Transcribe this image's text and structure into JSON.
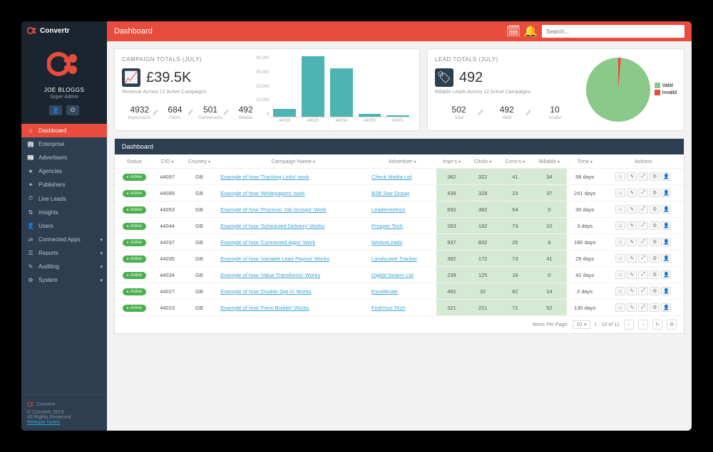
{
  "brand": "Convertr",
  "header": {
    "title": "Dashboard",
    "search_placeholder": "Search..."
  },
  "profile": {
    "name": "JOE BLOGGS",
    "role": "Super Admin"
  },
  "nav": [
    {
      "label": "Dashboard",
      "icon": "⌂",
      "active": true
    },
    {
      "label": "Enterprise",
      "icon": "🏢",
      "expand": false
    },
    {
      "label": "Advertisers",
      "icon": "📰",
      "expand": false
    },
    {
      "label": "Agencies",
      "icon": "★",
      "expand": false
    },
    {
      "label": "Publishers",
      "icon": "✦",
      "expand": false
    },
    {
      "label": "Live Leads",
      "icon": "⏱",
      "expand": false
    },
    {
      "label": "Insights",
      "icon": "⇅",
      "expand": false
    },
    {
      "label": "Users",
      "icon": "👤",
      "expand": false
    },
    {
      "label": "Connected Apps",
      "icon": "⇄",
      "expand": true
    },
    {
      "label": "Reports",
      "icon": "☰",
      "expand": true
    },
    {
      "label": "Auditing",
      "icon": "✎",
      "expand": true
    },
    {
      "label": "System",
      "icon": "⚙",
      "expand": true
    }
  ],
  "footer": {
    "copyright": "© Convertr 2019",
    "rights": "All Rights Reserved",
    "link": "Release Notes"
  },
  "campaign_card": {
    "title": "CAMPAIGN TOTALS (JULY)",
    "value": "£39.5K",
    "subtitle": "Revenue Across 12 Active Campaigns",
    "stats": [
      {
        "value": "4932",
        "label": "Impressions"
      },
      {
        "value": "684",
        "label": "Clicks"
      },
      {
        "value": "501",
        "label": "Conversions"
      },
      {
        "value": "492",
        "label": "Billable"
      }
    ]
  },
  "lead_card": {
    "title": "LEAD TOTALS (JULY)",
    "value": "492",
    "subtitle": "Billable Leads Across 12 Active Campaigns",
    "stats": [
      {
        "value": "502",
        "label": "Total"
      },
      {
        "value": "492",
        "label": "Valid"
      },
      {
        "value": "10",
        "label": "Invalid"
      }
    ],
    "legend": [
      {
        "label": "Valid",
        "color": "#8bc98b"
      },
      {
        "label": "Invalid",
        "color": "#e74c3c"
      }
    ]
  },
  "chart_data": {
    "type": "bar",
    "categories": [
      "44035",
      "44023",
      "44004",
      "44053",
      "44001"
    ],
    "values": [
      5000,
      40000,
      32000,
      2000,
      1000
    ],
    "ylim": [
      0,
      40000
    ],
    "y_ticks": [
      "40,000",
      "30,000",
      "20,000",
      "10,000",
      "0"
    ],
    "title": "",
    "xlabel": "",
    "ylabel": ""
  },
  "pie_data": {
    "type": "pie",
    "slices": [
      {
        "name": "Valid",
        "value": 492
      },
      {
        "name": "Invalid",
        "value": 10
      }
    ]
  },
  "table": {
    "title": "Dashboard",
    "columns": [
      "Status",
      "CID",
      "Country",
      "Campaign Name",
      "Advertiser",
      "Impr's",
      "Clicks",
      "Conv's",
      "Billable",
      "Time",
      "Actions"
    ],
    "rows": [
      {
        "status": "Active",
        "cid": "44097",
        "country": "GB",
        "name": "Example of how 'Tracking Links' work",
        "advertiser": "Check Media Ltd",
        "imprs": 382,
        "clicks": 322,
        "convs": 41,
        "billable": 34,
        "time": "58 days"
      },
      {
        "status": "Active",
        "cid": "44089",
        "country": "GB",
        "name": "Example of how 'Whitepapers' work",
        "advertiser": "B2B Star Group",
        "imprs": 439,
        "clicks": 328,
        "convs": 23,
        "billable": 37,
        "time": "241 days"
      },
      {
        "status": "Active",
        "cid": "44053",
        "country": "GB",
        "name": "Example of how 'Processr Job Groups' Work",
        "advertiser": "Leadermetrics",
        "imprs": 692,
        "clicks": 382,
        "convs": 54,
        "billable": 0,
        "time": "30 days"
      },
      {
        "status": "Active",
        "cid": "44044",
        "country": "GB",
        "name": "Example of how 'Scheduled Delivery' Works",
        "advertiser": "Prosper Tech",
        "imprs": 283,
        "clicks": 192,
        "convs": 73,
        "billable": 10,
        "time": "3 days"
      },
      {
        "status": "Active",
        "cid": "44037",
        "country": "GB",
        "name": "Example of how 'Connected Apps' Work",
        "advertiser": "WeAreLeads",
        "imprs": 937,
        "clicks": 832,
        "convs": 25,
        "billable": 6,
        "time": "180 days"
      },
      {
        "status": "Active",
        "cid": "44035",
        "country": "GB",
        "name": "Example of how 'Variable Lead Payout' Works",
        "advertiser": "Landscape Tracker",
        "imprs": 392,
        "clicks": 172,
        "convs": 73,
        "billable": 41,
        "time": "29 days"
      },
      {
        "status": "Active",
        "cid": "44034",
        "country": "GB",
        "name": "Example of how 'Value Transforms' Works",
        "advertiser": "Digital Swarm Ltd",
        "imprs": 239,
        "clicks": 125,
        "convs": 16,
        "billable": 0,
        "time": "42 days"
      },
      {
        "status": "Active",
        "cid": "44027",
        "country": "GB",
        "name": "Example of how 'Double Opt in' Works",
        "advertiser": "Excellerate",
        "imprs": 492,
        "clicks": 32,
        "convs": 82,
        "billable": 14,
        "time": "2 days"
      },
      {
        "status": "Active",
        "cid": "44023",
        "country": "GB",
        "name": "Example of how 'Form Builder' Works",
        "advertiser": "FindYour.Tech",
        "imprs": 321,
        "clicks": 221,
        "convs": 72,
        "billable": 52,
        "time": "130 days"
      }
    ],
    "footer": {
      "per_page_label": "Items Per Page:",
      "per_page": "10",
      "range": "1 - 10 of 12"
    }
  },
  "action_icons": [
    "⌂",
    "✎",
    "⤢",
    "⚙",
    "👤"
  ]
}
